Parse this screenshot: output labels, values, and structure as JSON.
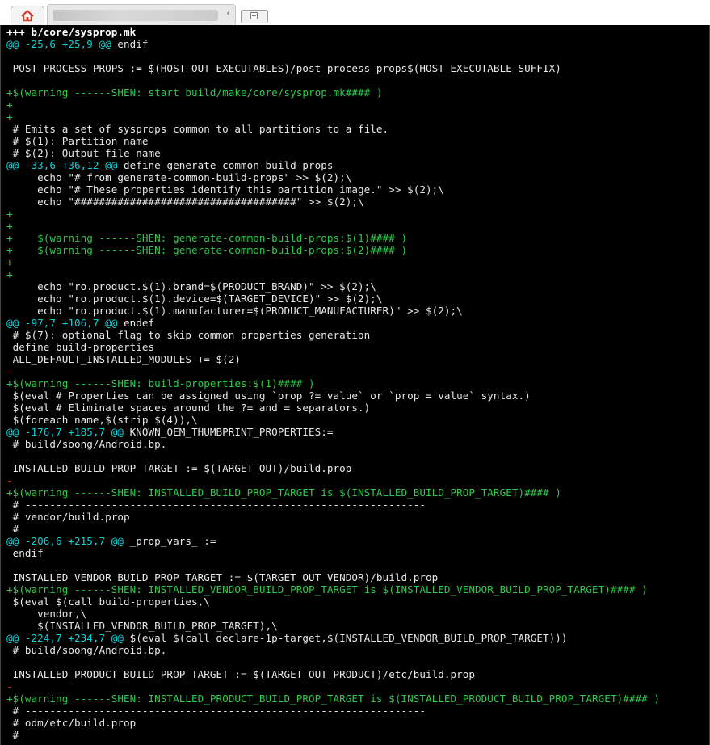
{
  "window": {
    "home_tab_icon": "house-icon",
    "active_tab_title": "",
    "new_tab_icon": "plus-icon"
  },
  "colors": {
    "context": "#e8e8e8",
    "hunk": "#0ad0d8",
    "added": "#2ec84a",
    "removed": "#e02020"
  },
  "diff": [
    {
      "t": "meta",
      "text": "+++ b/core/sysprop.mk"
    },
    {
      "t": "hunk",
      "text": "@@ -25,6 +25,9 @@",
      "tail": " endif"
    },
    {
      "t": "ctx",
      "text": ""
    },
    {
      "t": "ctx",
      "text": " POST_PROCESS_PROPS := $(HOST_OUT_EXECUTABLES)/post_process_props$(HOST_EXECUTABLE_SUFFIX)"
    },
    {
      "t": "ctx",
      "text": ""
    },
    {
      "t": "add",
      "text": "+$(warning ------SHEN: start build/make/core/sysprop.mk#### )"
    },
    {
      "t": "add",
      "text": "+"
    },
    {
      "t": "add",
      "text": "+"
    },
    {
      "t": "ctx",
      "text": " # Emits a set of sysprops common to all partitions to a file."
    },
    {
      "t": "ctx",
      "text": " # $(1): Partition name"
    },
    {
      "t": "ctx",
      "text": " # $(2): Output file name"
    },
    {
      "t": "hunk",
      "text": "@@ -33,6 +36,12 @@",
      "tail": " define generate-common-build-props"
    },
    {
      "t": "ctx",
      "text": "     echo \"# from generate-common-build-props\" >> $(2);\\"
    },
    {
      "t": "ctx",
      "text": "     echo \"# These properties identify this partition image.\" >> $(2);\\"
    },
    {
      "t": "ctx",
      "text": "     echo \"####################################\" >> $(2);\\"
    },
    {
      "t": "add",
      "text": "+"
    },
    {
      "t": "add",
      "text": "+"
    },
    {
      "t": "add",
      "text": "+    $(warning ------SHEN: generate-common-build-props:$(1)#### )"
    },
    {
      "t": "add",
      "text": "+    $(warning ------SHEN: generate-common-build-props:$(2)#### )"
    },
    {
      "t": "add",
      "text": "+"
    },
    {
      "t": "add",
      "text": "+"
    },
    {
      "t": "ctx",
      "text": "     echo \"ro.product.$(1).brand=$(PRODUCT_BRAND)\" >> $(2);\\"
    },
    {
      "t": "ctx",
      "text": "     echo \"ro.product.$(1).device=$(TARGET_DEVICE)\" >> $(2);\\"
    },
    {
      "t": "ctx",
      "text": "     echo \"ro.product.$(1).manufacturer=$(PRODUCT_MANUFACTURER)\" >> $(2);\\"
    },
    {
      "t": "hunk",
      "text": "@@ -97,7 +106,7 @@",
      "tail": " endef"
    },
    {
      "t": "ctx",
      "text": " # $(7): optional flag to skip common properties generation"
    },
    {
      "t": "ctx",
      "text": " define build-properties"
    },
    {
      "t": "ctx",
      "text": " ALL_DEFAULT_INSTALLED_MODULES += $(2)"
    },
    {
      "t": "del",
      "text": "-"
    },
    {
      "t": "add",
      "text": "+$(warning ------SHEN: build-properties:$(1)#### )"
    },
    {
      "t": "ctx",
      "text": " $(eval # Properties can be assigned using `prop ?= value` or `prop = value` syntax.)"
    },
    {
      "t": "ctx",
      "text": " $(eval # Eliminate spaces around the ?= and = separators.)"
    },
    {
      "t": "ctx",
      "text": " $(foreach name,$(strip $(4)),\\"
    },
    {
      "t": "hunk",
      "text": "@@ -176,7 +185,7 @@",
      "tail": " KNOWN_OEM_THUMBPRINT_PROPERTIES:="
    },
    {
      "t": "ctx",
      "text": " # build/soong/Android.bp."
    },
    {
      "t": "ctx",
      "text": ""
    },
    {
      "t": "ctx",
      "text": " INSTALLED_BUILD_PROP_TARGET := $(TARGET_OUT)/build.prop"
    },
    {
      "t": "del",
      "text": "-"
    },
    {
      "t": "add",
      "text": "+$(warning ------SHEN: INSTALLED_BUILD_PROP_TARGET is $(INSTALLED_BUILD_PROP_TARGET)#### )"
    },
    {
      "t": "ctx",
      "text": " # -----------------------------------------------------------------"
    },
    {
      "t": "ctx",
      "text": " # vendor/build.prop"
    },
    {
      "t": "ctx",
      "text": " #"
    },
    {
      "t": "hunk",
      "text": "@@ -206,6 +215,7 @@",
      "tail": " _prop_vars_ :="
    },
    {
      "t": "ctx",
      "text": " endif"
    },
    {
      "t": "ctx",
      "text": ""
    },
    {
      "t": "ctx",
      "text": " INSTALLED_VENDOR_BUILD_PROP_TARGET := $(TARGET_OUT_VENDOR)/build.prop"
    },
    {
      "t": "add",
      "text": "+$(warning ------SHEN: INSTALLED_VENDOR_BUILD_PROP_TARGET is $(INSTALLED_VENDOR_BUILD_PROP_TARGET)#### )"
    },
    {
      "t": "ctx",
      "text": " $(eval $(call build-properties,\\"
    },
    {
      "t": "ctx",
      "text": "     vendor,\\"
    },
    {
      "t": "ctx",
      "text": "     $(INSTALLED_VENDOR_BUILD_PROP_TARGET),\\"
    },
    {
      "t": "hunk",
      "text": "@@ -224,7 +234,7 @@",
      "tail": " $(eval $(call declare-1p-target,$(INSTALLED_VENDOR_BUILD_PROP_TARGET)))"
    },
    {
      "t": "ctx",
      "text": " # build/soong/Android.bp."
    },
    {
      "t": "ctx",
      "text": ""
    },
    {
      "t": "ctx",
      "text": " INSTALLED_PRODUCT_BUILD_PROP_TARGET := $(TARGET_OUT_PRODUCT)/etc/build.prop"
    },
    {
      "t": "del",
      "text": "-"
    },
    {
      "t": "add",
      "text": "+$(warning ------SHEN: INSTALLED_PRODUCT_BUILD_PROP_TARGET is $(INSTALLED_PRODUCT_BUILD_PROP_TARGET)#### )"
    },
    {
      "t": "ctx",
      "text": " # -----------------------------------------------------------------"
    },
    {
      "t": "ctx",
      "text": " # odm/etc/build.prop"
    },
    {
      "t": "ctx",
      "text": " #"
    }
  ]
}
